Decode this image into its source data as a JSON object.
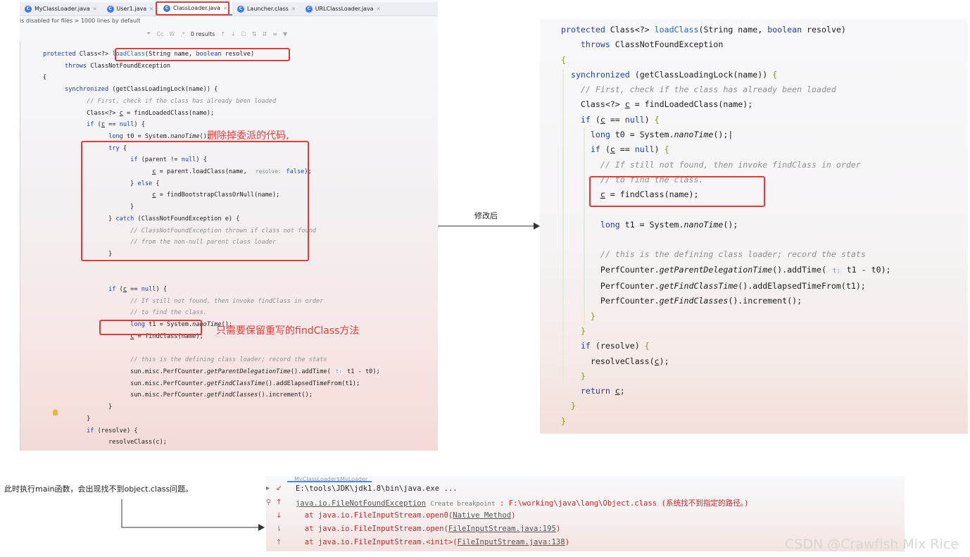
{
  "left_ide": {
    "tabs": [
      {
        "label": "MyClassLoader.java"
      },
      {
        "label": "User1.java"
      },
      {
        "label": "ClassLoader.java"
      },
      {
        "label": "Launcher.class"
      },
      {
        "label": "URLClassLoader.java"
      }
    ],
    "notice": "is disabled for files > 1000 lines by default",
    "search": {
      "results": "0 results",
      "cc": "Cc",
      "w": "W",
      "regex": ".*"
    },
    "annotation_delete": "删除掉委派的代码,",
    "annotation_keep": "只需要保留重写的findClass方法",
    "hint_resolve": "resolve:",
    "hint_t": "t:"
  },
  "right_code": {
    "hint_t": "t:"
  },
  "arrow_caption": "修改后",
  "bottom_caption": "此时执行main函数，会出现找不到object.class问题。",
  "console": {
    "tab_title": "MyClassLoader$MyLoader",
    "lines": [
      {
        "text": "E:\\tools\\JDK\\jdk1.8\\bin\\java.exe ..."
      },
      {
        "exception": "java.io.FileNotFoundException",
        "breakpoint": "Create breakpoint",
        "rest": " : F:\\working\\java\\lang\\Object.class (系统找不到指定的路径。)"
      },
      {
        "prefix": "  at java.io.FileInputStream.open0(",
        "link": "Native Method",
        "suffix": ")"
      },
      {
        "prefix": "  at java.io.FileInputStream.open(",
        "link": "FileInputStream.java:195",
        "suffix": ")"
      },
      {
        "prefix": "  at java.io.FileInputStream.<init>(",
        "link": "FileInputStream.java:138",
        "suffix": ")"
      }
    ]
  },
  "watermark": "CSDN @Crawfish Mix Rice"
}
